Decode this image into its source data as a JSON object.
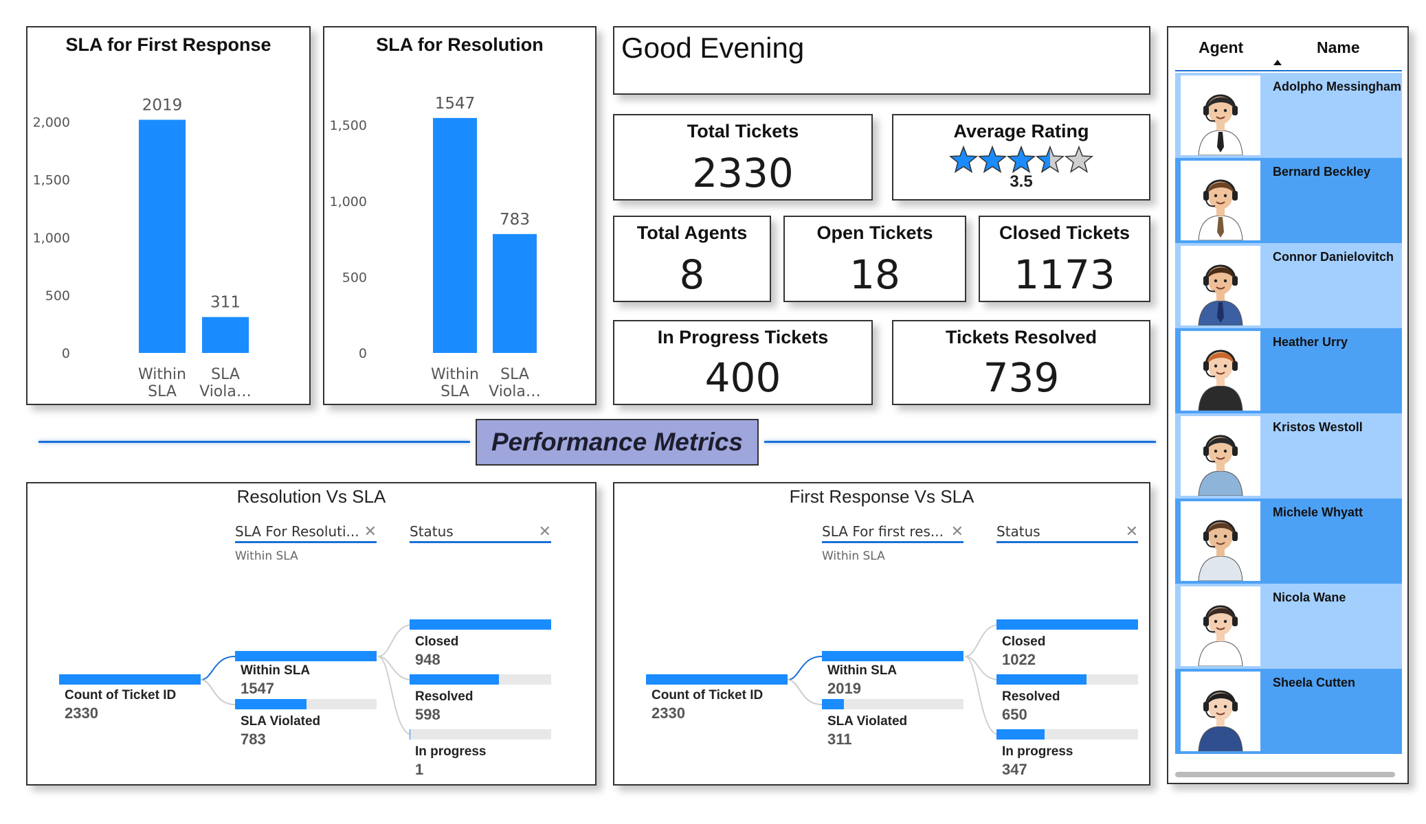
{
  "sla_first_response": {
    "title": "SLA for First Response",
    "chart_data": {
      "type": "bar",
      "title": "SLA for First Response",
      "categories": [
        "Within SLA",
        "SLA Viola…"
      ],
      "category_lines": [
        [
          "Within",
          "SLA"
        ],
        [
          "SLA",
          "Viola…"
        ]
      ],
      "values": [
        2019,
        311
      ],
      "ylim": [
        0,
        2200
      ],
      "yticks": [
        0,
        500,
        1000,
        1500,
        2000
      ],
      "ytick_labels": [
        "0",
        "500",
        "1,000",
        "1,500",
        "2,000"
      ],
      "data_labels": [
        "2019",
        "311"
      ],
      "color": "#1a8cff"
    }
  },
  "sla_resolution": {
    "title": "SLA for Resolution",
    "chart_data": {
      "type": "bar",
      "title": "SLA for Resolution",
      "categories": [
        "Within SLA",
        "SLA Viola…"
      ],
      "category_lines": [
        [
          "Within",
          "SLA"
        ],
        [
          "SLA",
          "Viola…"
        ]
      ],
      "values": [
        1547,
        783
      ],
      "ylim": [
        0,
        1700
      ],
      "yticks": [
        0,
        500,
        1000,
        1500
      ],
      "ytick_labels": [
        "0",
        "500",
        "1,000",
        "1,500"
      ],
      "data_labels": [
        "1547",
        "783"
      ],
      "color": "#1a8cff"
    }
  },
  "greeting": "Good Evening",
  "kpis": {
    "total_tickets": {
      "label": "Total Tickets",
      "value": "2330"
    },
    "average_rating": {
      "label": "Average Rating",
      "value": "3.5",
      "stars_filled": 3.5,
      "stars_max": 5
    },
    "total_agents": {
      "label": "Total Agents",
      "value": "8"
    },
    "open_tickets": {
      "label": "Open Tickets",
      "value": "18"
    },
    "closed_tickets": {
      "label": "Closed Tickets",
      "value": "1173"
    },
    "in_progress_tickets": {
      "label": "In Progress Tickets",
      "value": "400"
    },
    "tickets_resolved": {
      "label": "Tickets Resolved",
      "value": "739"
    }
  },
  "section_title": "Performance Metrics",
  "resolution_tree": {
    "title": "Resolution Vs SLA",
    "filter1": {
      "label": "SLA For Resoluti...",
      "selected": "Within SLA"
    },
    "filter2": {
      "label": "Status"
    },
    "root": {
      "label": "Count of Ticket ID",
      "value": "2330",
      "fill": 1.0
    },
    "level1": [
      {
        "label": "Within SLA",
        "value": "1547",
        "fill": 1.0
      },
      {
        "label": "SLA Violated",
        "value": "783",
        "fill": 0.506
      }
    ],
    "level2": [
      {
        "label": "Closed",
        "value": "948",
        "fill": 1.0
      },
      {
        "label": "Resolved",
        "value": "598",
        "fill": 0.631
      },
      {
        "label": "In progress",
        "value": "1",
        "fill": 0.001
      }
    ]
  },
  "first_response_tree": {
    "title": "First Response Vs SLA",
    "filter1": {
      "label": "SLA For first res...",
      "selected": "Within SLA"
    },
    "filter2": {
      "label": "Status"
    },
    "root": {
      "label": "Count of Ticket ID",
      "value": "2330",
      "fill": 1.0
    },
    "level1": [
      {
        "label": "Within SLA",
        "value": "2019",
        "fill": 1.0
      },
      {
        "label": "SLA Violated",
        "value": "311",
        "fill": 0.154
      }
    ],
    "level2": [
      {
        "label": "Closed",
        "value": "1022",
        "fill": 1.0
      },
      {
        "label": "Resolved",
        "value": "650",
        "fill": 0.636
      },
      {
        "label": "In progress",
        "value": "347",
        "fill": 0.34
      }
    ]
  },
  "agents_table": {
    "col_agent": "Agent",
    "col_name": "Name",
    "sort_icon": "sort-up-icon",
    "colors": {
      "light": "#a3cfff",
      "dark": "#4da1f5"
    },
    "rows": [
      {
        "name": "Adolpho Messingham",
        "tone": "light",
        "avatar": {
          "skin": "#f2c9a5",
          "hair": "#2b2b2b",
          "shirt": "#ffffff",
          "tie": "#222222",
          "headset": true
        }
      },
      {
        "name": "Bernard Beckley",
        "tone": "dark",
        "avatar": {
          "skin": "#f1c39c",
          "hair": "#6b4424",
          "shirt": "#ffffff",
          "tie": "#7a5a3a",
          "headset": true
        }
      },
      {
        "name": "Connor Danielovitch",
        "tone": "light",
        "avatar": {
          "skin": "#eebf96",
          "hair": "#4a2e17",
          "shirt": "#3b5fa0",
          "tie": "#1c3266",
          "headset": true
        }
      },
      {
        "name": "Heather Urry",
        "tone": "dark",
        "avatar": {
          "skin": "#f6cfb0",
          "hair": "#c9662d",
          "shirt": "#2b2b2b",
          "tie": "",
          "headset": true
        }
      },
      {
        "name": "Kristos Westoll",
        "tone": "light",
        "avatar": {
          "skin": "#f0c6a0",
          "hair": "#2a2a2a",
          "shirt": "#8fb4d9",
          "tie": "",
          "headset": true
        }
      },
      {
        "name": "Michele Whyatt",
        "tone": "dark",
        "avatar": {
          "skin": "#eabf98",
          "hair": "#5a3a22",
          "shirt": "#dfe6ee",
          "tie": "",
          "headset": true
        }
      },
      {
        "name": "Nicola Wane",
        "tone": "light",
        "avatar": {
          "skin": "#f5cfb2",
          "hair": "#3b2a22",
          "shirt": "#ffffff",
          "tie": "",
          "headset": true
        }
      },
      {
        "name": "Sheela Cutten",
        "tone": "dark",
        "avatar": {
          "skin": "#f5d3b8",
          "hair": "#1e1e1e",
          "shirt": "#2f4f8f",
          "tie": "",
          "headset": true
        }
      }
    ]
  }
}
